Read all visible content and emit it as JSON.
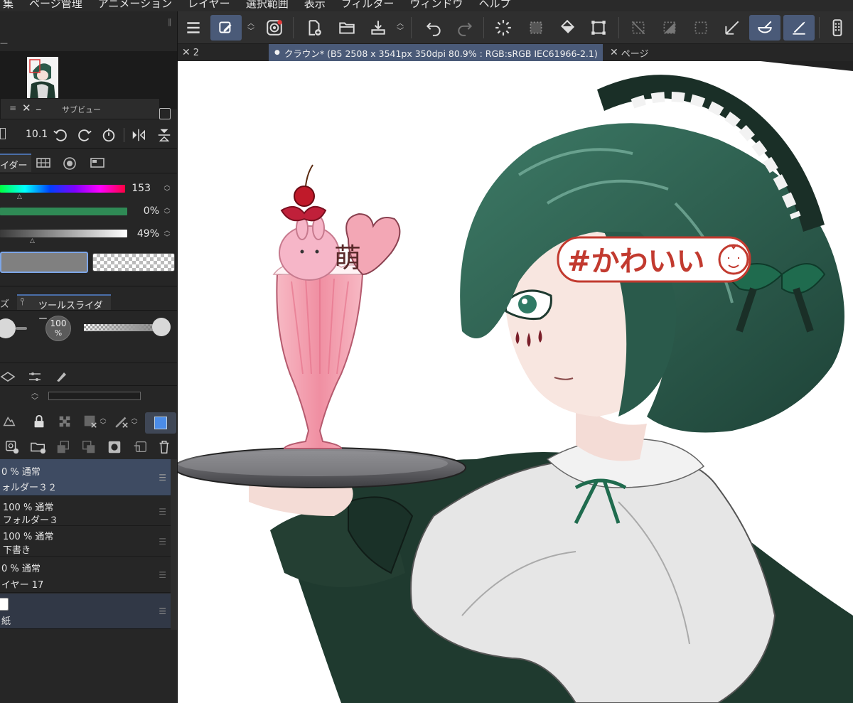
{
  "menubar": {
    "items": [
      "集",
      "ページ管理",
      "アニメーション",
      "レイヤー",
      "選択範囲",
      "表示",
      "フィルター",
      "ウィンドウ",
      "ヘルプ"
    ]
  },
  "tabs": [
    {
      "label": "2",
      "close": "✕",
      "active": false
    },
    {
      "label": "クラウン* (B5 2508 x 3541px 350dpi 80.9% : RGB:sRGB IEC61966-2.1)",
      "close": "●",
      "active": true
    },
    {
      "label": "ページ",
      "close": "✕",
      "active": false
    }
  ],
  "navigator": {
    "subview_title": "サブビュー",
    "zoom_value": "10.1"
  },
  "color_slider": {
    "tab_label": "イダー",
    "hue_value": "153",
    "saturation_value": "0%",
    "brightness_value": "49%",
    "main_color": "#808080"
  },
  "tool_property": {
    "tab_left": "ズ",
    "tab_right": "ツールスライダー",
    "opacity_value": "100",
    "opacity_unit": "%"
  },
  "layers": [
    {
      "mode": "0 % 通常",
      "name": "ォルダー３２",
      "selected": true
    },
    {
      "mode": "100 % 通常",
      "name": "フォルダー３",
      "selected": false
    },
    {
      "mode": "100 % 通常",
      "name": "下書き",
      "selected": false
    },
    {
      "mode": "0 % 通常",
      "name": "イヤー 17",
      "selected": false
    },
    {
      "mode": "",
      "name": "紙",
      "selected": false
    }
  ],
  "artwork": {
    "caption": "#かわいい",
    "kanji": "萌",
    "hair_color": "#2c5a4b",
    "dress_color": "#1f3a2f",
    "parfait_color": "#f2a0ad"
  }
}
